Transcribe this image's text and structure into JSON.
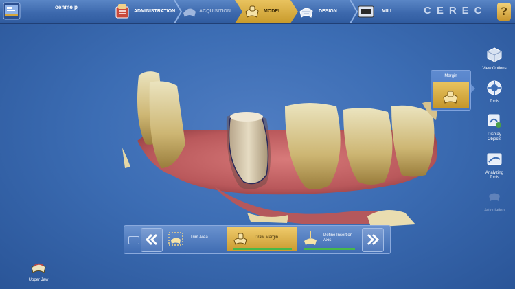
{
  "header": {
    "patient_name": "oehme p",
    "brand": "CEREC",
    "help_glyph": "?",
    "steps": [
      {
        "label": "ADMINISTRATION",
        "state": "done"
      },
      {
        "label": "ACQUISITION",
        "state": "disabled"
      },
      {
        "label": "MODEL",
        "state": "active"
      },
      {
        "label": "DESIGN",
        "state": "normal"
      },
      {
        "label": "MILL",
        "state": "normal"
      }
    ]
  },
  "right_tools": [
    {
      "label": "View Options",
      "icon": "cube-icon"
    },
    {
      "label": "Tools",
      "icon": "lifebuoy-icon"
    },
    {
      "label": "Display Objects",
      "icon": "display-objects-icon"
    },
    {
      "label": "Analyzing Tools",
      "icon": "analyzing-tools-icon"
    },
    {
      "label": "Articulation",
      "icon": "articulation-icon",
      "disabled": true
    }
  ],
  "margin_panel": {
    "title": "Margin"
  },
  "workflow": {
    "steps": [
      {
        "label": "Trim Area",
        "state": "normal"
      },
      {
        "label": "Draw Margin",
        "state": "active"
      },
      {
        "label": "Define Insertion Axis",
        "state": "normal"
      }
    ],
    "prev_icon": "double-chevron-left-icon",
    "next_icon": "double-chevron-right-icon"
  },
  "jaw": {
    "label": "Upper Jaw"
  },
  "colors": {
    "accent_gold": "#d6a63a",
    "background_blue": "#3c6db4",
    "progress_green": "#47b84a"
  }
}
